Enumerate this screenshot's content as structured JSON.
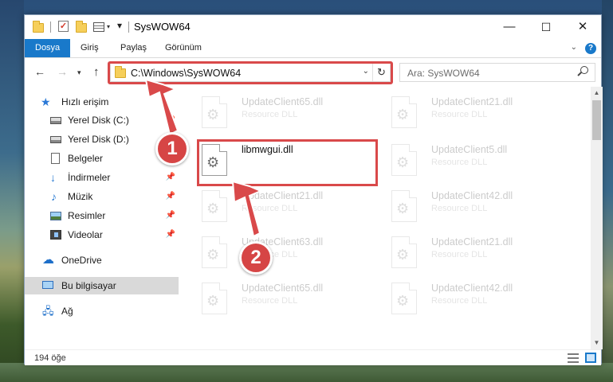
{
  "window": {
    "title": "SysWOW64",
    "controls": {
      "minimize": "—",
      "maximize": "☐",
      "close": "✕"
    }
  },
  "ribbon": {
    "tabs": [
      "Dosya",
      "Giriş",
      "Paylaş",
      "Görünüm"
    ],
    "active_tab": "Dosya",
    "accent": "#1979ca"
  },
  "address_bar": {
    "path": "C:\\Windows\\SysWOW64",
    "search_placeholder": "Ara: SysWOW64"
  },
  "sidebar": {
    "items": [
      {
        "label": "Hızlı erişim",
        "icon": "star-icon",
        "pinned": false
      },
      {
        "label": "Yerel Disk (C:)",
        "icon": "drive-icon",
        "pinned": true
      },
      {
        "label": "Yerel Disk (D:)",
        "icon": "drive-icon",
        "pinned": true
      },
      {
        "label": "Belgeler",
        "icon": "documents-icon",
        "pinned": true
      },
      {
        "label": "İndirmeler",
        "icon": "download-icon",
        "pinned": true
      },
      {
        "label": "Müzik",
        "icon": "music-icon",
        "pinned": true
      },
      {
        "label": "Resimler",
        "icon": "pictures-icon",
        "pinned": true
      },
      {
        "label": "Videolar",
        "icon": "videos-icon",
        "pinned": true
      },
      {
        "label": "OneDrive",
        "icon": "cloud-icon",
        "pinned": false
      },
      {
        "label": "Bu bilgisayar",
        "icon": "computer-icon",
        "pinned": false,
        "selected": true
      },
      {
        "label": "Ağ",
        "icon": "network-icon",
        "pinned": false
      }
    ]
  },
  "files": [
    {
      "name": "UpdateClient65.dll",
      "type": "Resource DLL",
      "faded": true
    },
    {
      "name": "UpdateClient21.dll",
      "type": "Resource DLL",
      "faded": true
    },
    {
      "name": "libmwgui.dll",
      "type": "",
      "faded": false
    },
    {
      "name": "UpdateClient5.dll",
      "type": "Resource DLL",
      "faded": true
    },
    {
      "name": "UpdateClient21.dll",
      "type": "Resource DLL",
      "faded": true
    },
    {
      "name": "UpdateClient42.dll",
      "type": "Resource DLL",
      "faded": true
    },
    {
      "name": "UpdateClient63.dll",
      "type": "Resource DLL",
      "faded": true
    },
    {
      "name": "UpdateClient21.dll",
      "type": "Resource DLL",
      "faded": true
    },
    {
      "name": "UpdateClient65.dll",
      "type": "Resource DLL",
      "faded": true
    },
    {
      "name": "UpdateClient42.dll",
      "type": "Resource DLL",
      "faded": true
    }
  ],
  "status_bar": {
    "item_count": "194 öğe"
  },
  "annotations": {
    "step1": "1",
    "step2": "2",
    "color": "#d9494a"
  }
}
